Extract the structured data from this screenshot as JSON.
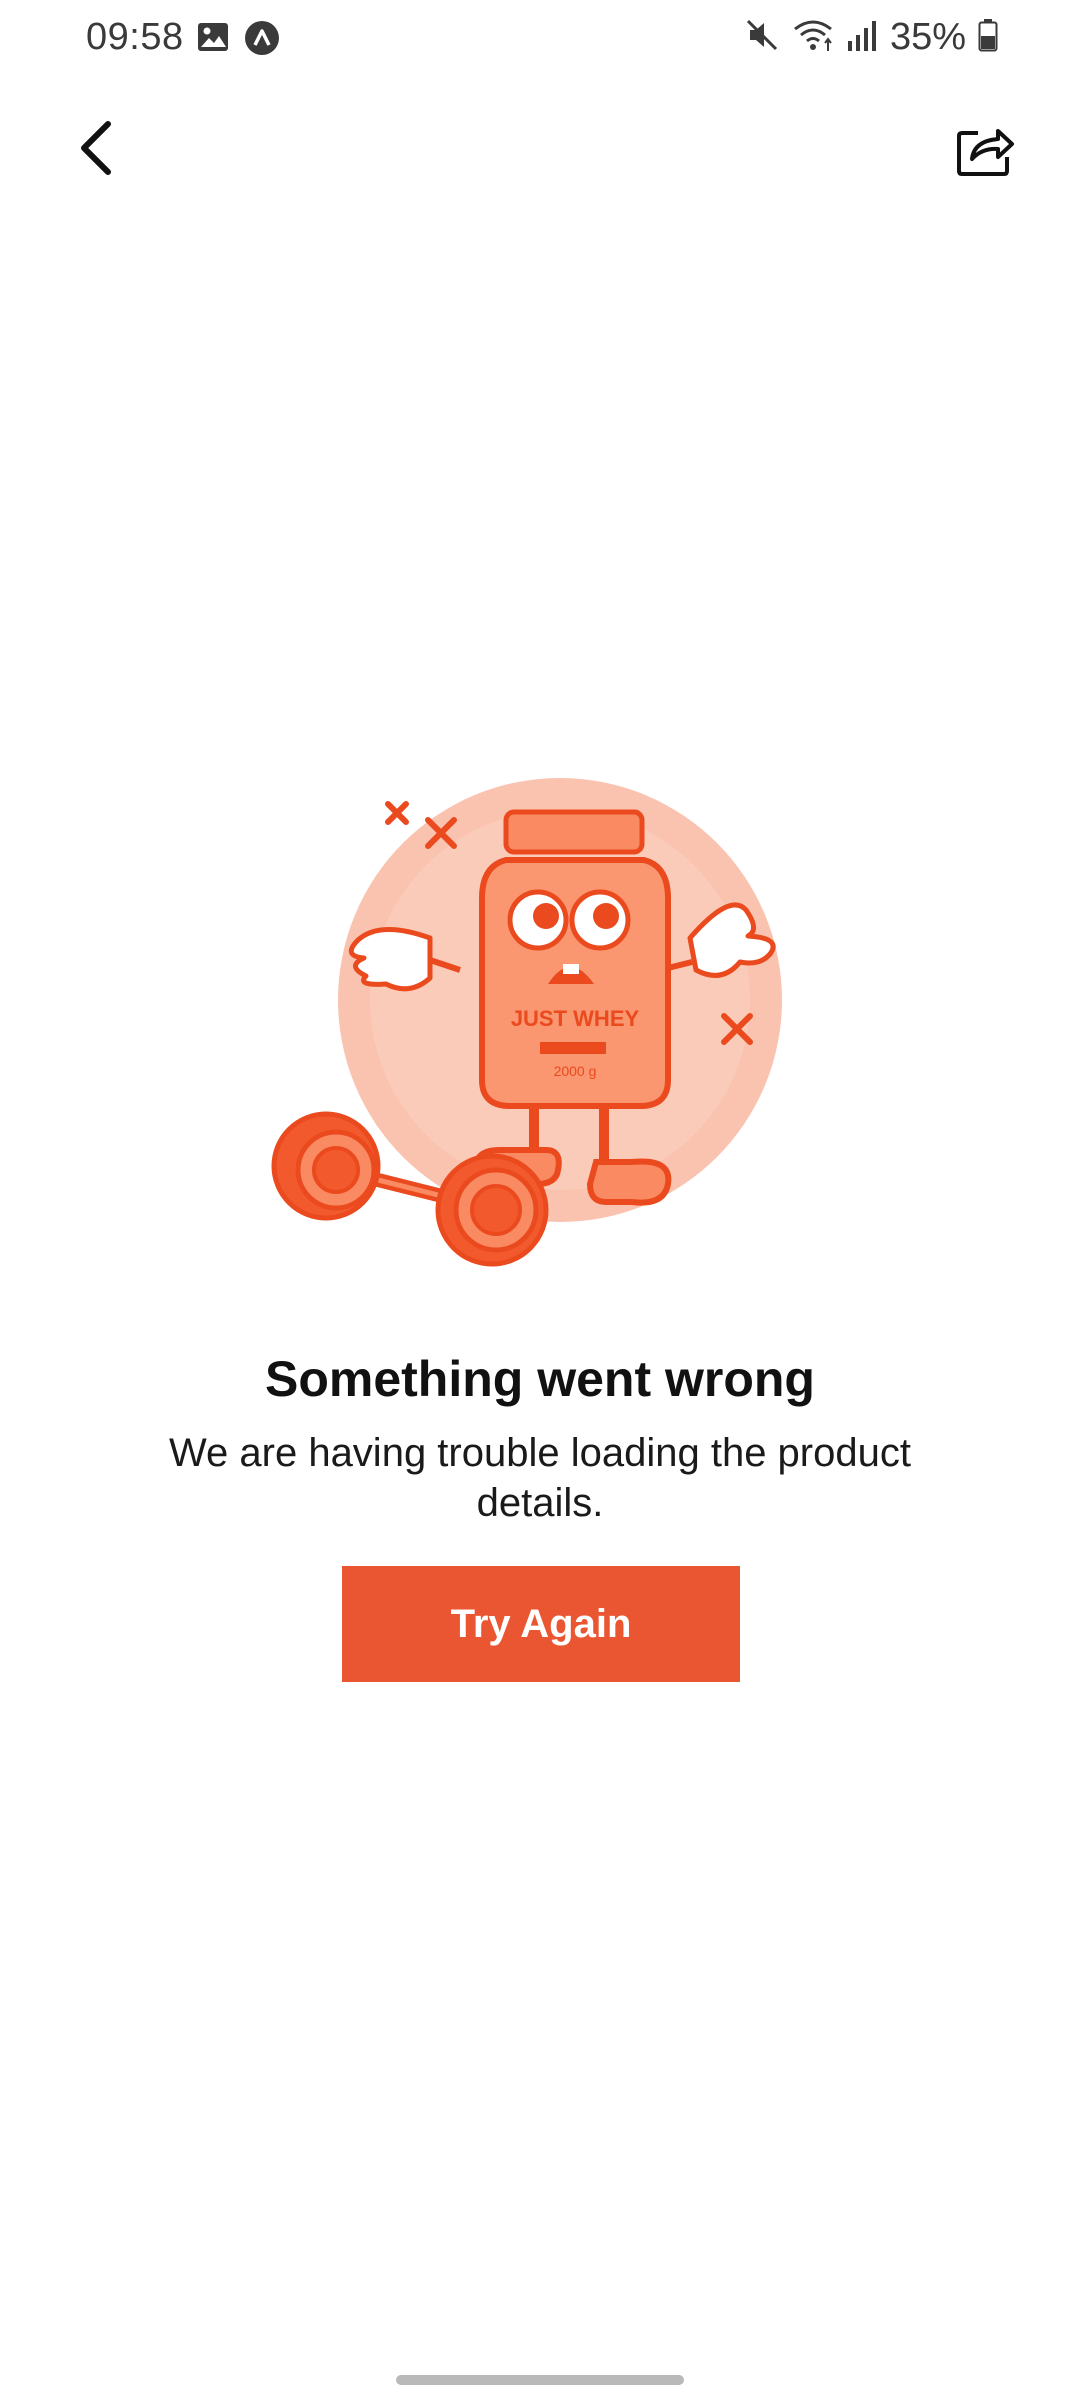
{
  "status_bar": {
    "time": "09:58",
    "battery": "35%",
    "icons": [
      "gallery-icon",
      "app-notification-icon",
      "mute-icon",
      "wifi-icon",
      "signal-icon",
      "battery-icon"
    ]
  },
  "header": {
    "back_icon": "chevron-left-icon",
    "share_icon": "share-icon"
  },
  "illustration": {
    "jar_label": "JUST WHEY",
    "jar_weight": "2000 g"
  },
  "error": {
    "title": "Something went wrong",
    "message": "We are having trouble loading the product details.",
    "button_label": "Try Again"
  },
  "colors": {
    "accent": "#eb5632",
    "illustration_bg": "#f9c3b0"
  }
}
